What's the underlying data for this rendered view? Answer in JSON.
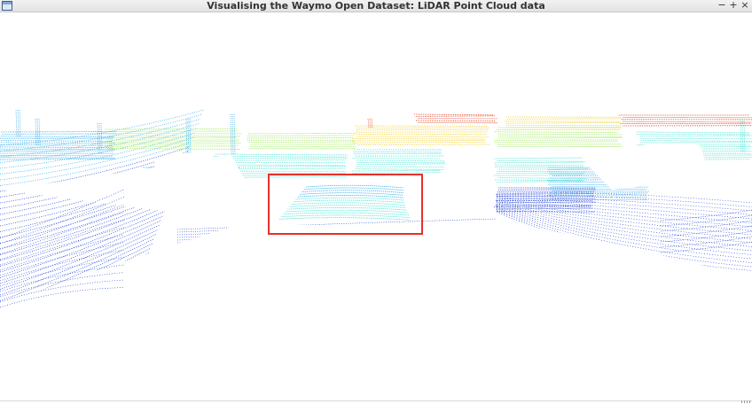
{
  "window": {
    "title": "Visualising the Waymo Open Dataset: LiDAR Point Cloud data",
    "minimize_glyph": "−",
    "maximize_glyph": "+",
    "close_glyph": "×",
    "app_icon": "window-app-icon"
  },
  "point_cloud": {
    "colormap": "jet (blue = low, red = high)",
    "colors": {
      "low": "#1c3cd6",
      "mid_low": "#2aa8e8",
      "mid": "#3fe0d0",
      "mid_high": "#8fe640",
      "high_yellow": "#f0d020",
      "high": "#e03818"
    },
    "highlight_color": "#e8302a"
  }
}
